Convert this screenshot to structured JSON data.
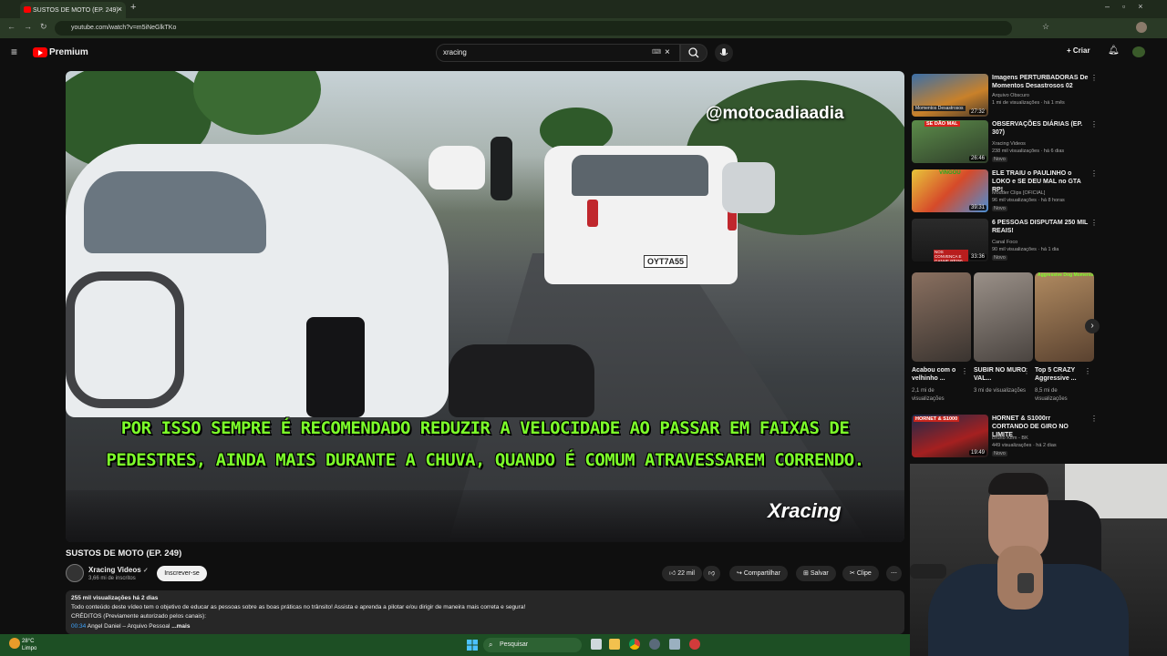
{
  "browser": {
    "tab_title": "SUSTOS DE MOTO (EP. 249)",
    "url": "youtube.com/watch?v=m5iNeGlkTKo"
  },
  "header": {
    "logo_text": "Premium",
    "search_value": "xracing",
    "create_label": "Criar"
  },
  "video": {
    "subtitle_line1": "POR ISSO SEMPRE É RECOMENDADO REDUZIR A VELOCIDADE AO PASSAR EM FAIXAS DE",
    "subtitle_line2": "PEDESTRES, AINDA MAIS DURANTE A CHUVA, QUANDO É COMUM ATRAVESSAREM CORRENDO.",
    "watermark": "@motocadiaadia",
    "channel_logo": "Xracing",
    "plate": "OYT7A55"
  },
  "info": {
    "title": "SUSTOS DE MOTO (EP. 249)",
    "channel": "Xracing Videos",
    "subscribers": "3,66 mi de inscritos",
    "subscribe_label": "Inscrever-se",
    "likes": "22 mil",
    "share_label": "Compartilhar",
    "save_label": "Salvar",
    "clip_label": "Clipe"
  },
  "description": {
    "stats": "255 mil visualizações  há 2 dias",
    "line1": "Todo conteúdo deste vídeo tem o objetivo de educar as pessoas sobre as boas práticas no trânsito! Assista e aprenda a pilotar e/ou dirigir de maneira mais correta e segura!",
    "line2": "CRÉDITOS (Previamente autorizado pelos canais):",
    "timestamp": "00:34",
    "line3": " Angel Daniel – Arquivo Pessoal ",
    "more": "...mais"
  },
  "recommendations": [
    {
      "title": "Imagens PERTURBADORAS De Momentos Desastrosos 02",
      "channel": "Arquivo Obscuro",
      "meta": "1 mi de visualizações · há 1 mês",
      "duration": "27:32",
      "thumb_text": "Momentos Desastrosos"
    },
    {
      "title": "OBSERVAÇÕES DIÁRIAS (EP. 307)",
      "channel": "Xracing Videos",
      "meta": "238 mil visualizações · há 6 dias",
      "duration": "26:46",
      "badge": "Novo",
      "thumb_text": "SE DÃO MAL"
    },
    {
      "title": "ELE TRAIU o PAULINHO o LOKO e SE DEU MAL no GTA RP!",
      "channel": "Modder Clips [OFICIAL]",
      "meta": "96 mil visualizações · há 8 horas",
      "duration": "39:31",
      "badge": "Novo",
      "thumb_text": "VINGOU"
    },
    {
      "title": "6 PESSOAS DISPUTAM 250 MIL REAIS!",
      "channel": "Canal Foco",
      "meta": "90 mil visualizações · há 1 dia",
      "duration": "33:36",
      "badge": "Novo",
      "thumb_text": "NOS CONVENCA E GANHE R$250 MIL"
    },
    {
      "title": "HORNET & S1000rr CORTANDO DE GIRO NO LIMITE",
      "channel": "Bruno Kem - BK",
      "meta": "449 visualizações · há 2 dias",
      "duration": "19:49",
      "badge": "Novo",
      "thumb_text": "HORNET & S1000"
    }
  ],
  "shorts": [
    {
      "title": "Acabou com o velhinho ...",
      "views": "2,1 mi de visualizações"
    },
    {
      "title": "SUBIR NO MURO VAL...",
      "views": "3 mi de visualizações"
    },
    {
      "title": "Top 5 CRAZY Aggressive ...",
      "views": "8,5 mi de visualizações",
      "overlay": "Aggressive Dog Moments"
    }
  ],
  "taskbar": {
    "temp": "28°C",
    "weather": "Limpo",
    "search_label": "Pesquisar"
  },
  "colors": {
    "yt_red": "#ff0000",
    "subtitle_green": "#7dff2a",
    "taskbar_green": "#1d4f24"
  }
}
